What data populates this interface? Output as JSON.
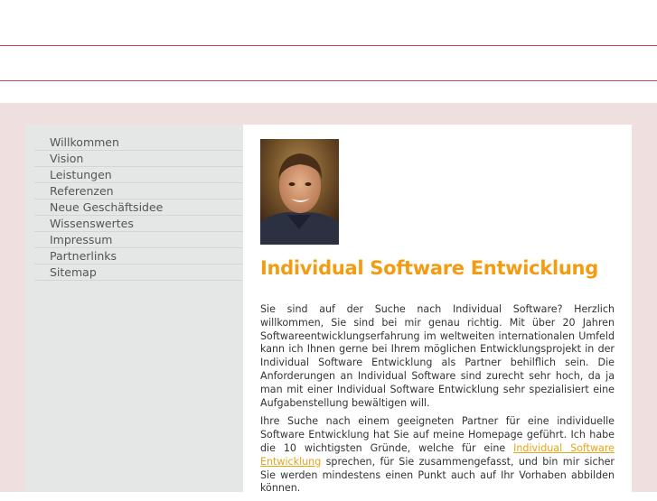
{
  "nav": {
    "items": [
      "Willkommen",
      "Vision",
      "Leistungen",
      "Referenzen",
      "Neue Geschäftsidee",
      "Wissenswertes",
      "Impressum",
      "Partnerlinks",
      "Sitemap"
    ]
  },
  "main": {
    "title": "Individual Software Entwicklung",
    "p1": "Sie sind auf der Suche nach Individual Software? Herzlich willkommen, Sie sind bei mir genau richtig. Mit über 20 Jahren Softwareentwicklungserfahrung im weltweiten internationalen Umfeld kann ich Ihnen gerne bei Ihrem möglichen Entwicklungsprojekt in der Individual Software Entwicklung als Partner behilflich sein. Die Anforderungen an Individual Software sind zurecht sehr hoch, da ja man mit einer Individual Software Entwicklung sehr spezialisiert eine Aufgabenstellung bewältigen will.",
    "p2_before": "Ihre Suche nach einem geeigneten Partner für eine individuelle Software Entwicklung hat Sie auf meine Homepage geführt. Ich habe die 10 wichtigsten Gründe, welche für eine ",
    "p2_link": "Individual Software Entwicklung",
    "p2_after": " sprechen, für Sie zusammengefasst, und bin mir sicher Sie werden mindestens einen Punkt auch auf Ihr Vorhaben abbilden können."
  },
  "colors": {
    "accent": "#f39c12",
    "header_line": "#c4485a",
    "band": "#f0dfdf",
    "sidebar": "#e5e6e6"
  },
  "icons": {
    "photo": "portrait-photo"
  }
}
